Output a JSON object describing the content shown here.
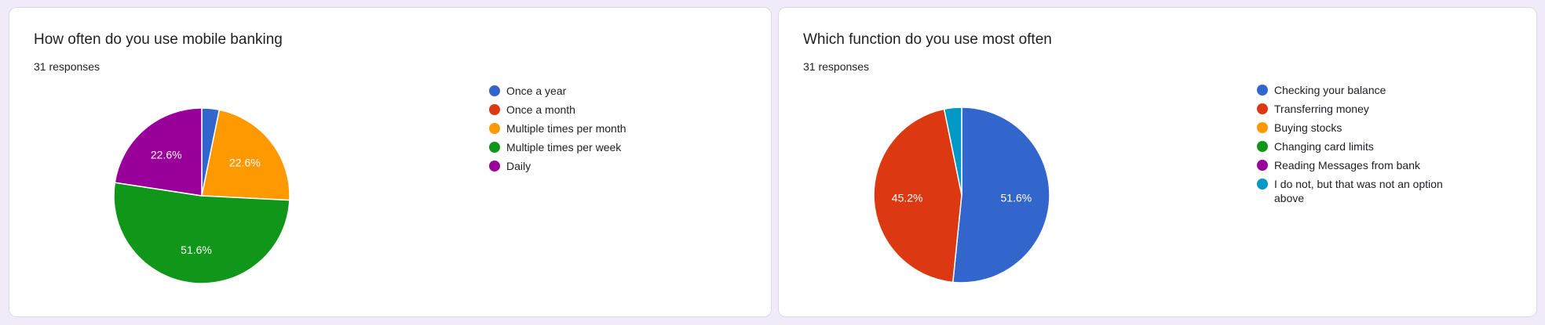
{
  "charts": [
    {
      "title": "How often do you use mobile banking",
      "responses": "31 responses"
    },
    {
      "title": "Which function do you use most often",
      "responses": "31 responses"
    }
  ],
  "chart_data": [
    {
      "type": "pie",
      "title": "How often do you use mobile banking",
      "categories": [
        "Once a year",
        "Once a month",
        "Multiple times per month",
        "Multiple times per week",
        "Daily"
      ],
      "values": [
        3.2,
        0,
        22.6,
        51.6,
        22.6
      ],
      "colors": [
        "#3366cc",
        "#dc3912",
        "#ff9900",
        "#109618",
        "#990099"
      ],
      "labels": [
        "",
        "",
        "22.6%",
        "51.6%",
        "22.6%"
      ],
      "legend": "right"
    },
    {
      "type": "pie",
      "title": "Which function do you use most often",
      "categories": [
        "Checking your balance",
        "Transferring money",
        "Buying stocks",
        "Changing card limits",
        "Reading Messages from bank",
        "I do not, but that was not an option above"
      ],
      "values": [
        51.6,
        45.2,
        0,
        0,
        0,
        3.2
      ],
      "colors": [
        "#3366cc",
        "#dc3912",
        "#ff9900",
        "#109618",
        "#990099",
        "#0099c6"
      ],
      "labels": [
        "51.6%",
        "45.2%",
        "",
        "",
        "",
        ""
      ],
      "legend": "right"
    }
  ]
}
